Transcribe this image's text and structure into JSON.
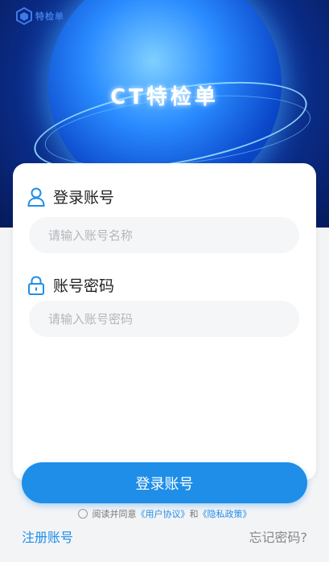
{
  "hero": {
    "title": "CT特检单",
    "logo_text": "特检单"
  },
  "form": {
    "account_label": "登录账号",
    "account_placeholder": "请输入账号名称",
    "password_label": "账号密码",
    "password_placeholder": "请输入账号密码"
  },
  "actions": {
    "login_label": "登录账号",
    "register_label": "注册账号",
    "forgot_label": "忘记密码?"
  },
  "agreement": {
    "prefix": "阅读并同意",
    "user_agreement": "《用户协议》",
    "and": "和",
    "privacy_policy": "《隐私政策》"
  },
  "colors": {
    "accent": "#1f8ee8"
  },
  "icons": {
    "account": "user-icon",
    "password": "lock-icon"
  }
}
